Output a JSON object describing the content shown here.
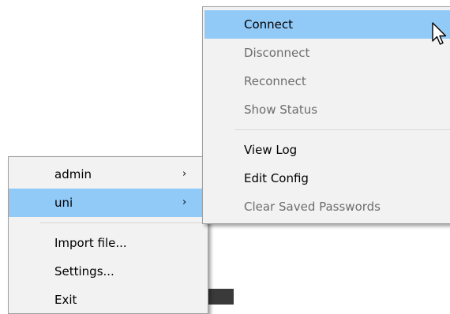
{
  "main_menu": {
    "items": [
      {
        "label": "admin",
        "has_submenu": true
      },
      {
        "label": "uni",
        "has_submenu": true,
        "highlighted": true
      },
      {
        "label": "Import file..."
      },
      {
        "label": "Settings..."
      },
      {
        "label": "Exit"
      }
    ],
    "submenu_arrow": "›"
  },
  "sub_menu": {
    "items": [
      {
        "label": "Connect",
        "highlighted": true
      },
      {
        "label": "Disconnect",
        "disabled": true
      },
      {
        "label": "Reconnect",
        "disabled": true
      },
      {
        "label": "Show Status",
        "disabled": true
      },
      {
        "label": "View Log"
      },
      {
        "label": "Edit Config"
      },
      {
        "label": "Clear Saved Passwords",
        "disabled": true
      }
    ]
  },
  "colors": {
    "highlight": "#91c9f7",
    "menu_bg": "#f2f2f2",
    "disabled_text": "#6d6d6d"
  },
  "cursor": "arrow-pointer-icon"
}
